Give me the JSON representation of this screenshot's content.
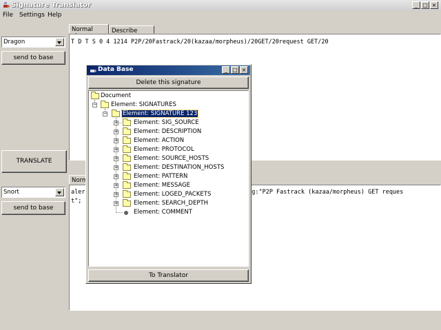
{
  "window": {
    "title": "Signature Translator",
    "controls": [
      "_",
      "□",
      "×"
    ]
  },
  "menu": {
    "items": [
      "File",
      "Settings",
      "Help"
    ]
  },
  "source": {
    "selected": "Dragon",
    "send_label": "send to base"
  },
  "target": {
    "selected": "Snort",
    "send_label": "send to base"
  },
  "translate_label": "TRANSLATE",
  "top_tabs": {
    "normal": "Normal view",
    "describe": "Describe view"
  },
  "bottom_tabs": {
    "normal": "Norm"
  },
  "top_text": "T D T S 0 4 1214 P2P/20Fastrack/20(kazaa/morpheus)/20GET/20request GET/20",
  "bottom_text": {
    "line1_left": "aler",
    "line1_right": "msg:\"P2P Fastrack (kazaa/morpheus) GET reques",
    "line2": "t\";"
  },
  "dialog": {
    "title": "Data Base",
    "delete_label": "Delete this signature",
    "to_translator_label": "To Translator",
    "tree": {
      "root": "Document",
      "signatures": "Element: SIGNATURES",
      "signature": "Element: SIGNATURE 123",
      "children": [
        "Element: SIG_SOURCE",
        "Element: DESCRIPTION",
        "Element: ACTION",
        "Element: PROTOCOL",
        "Element: SOURCE_HOSTS",
        "Element: DESTINATION_HOSTS",
        "Element: PATTERN",
        "Element: MESSAGE",
        "Element: LOGED_PACKETS",
        "Element: SEARCH_DEPTH"
      ],
      "leaf": "Element: COMMENT"
    }
  }
}
